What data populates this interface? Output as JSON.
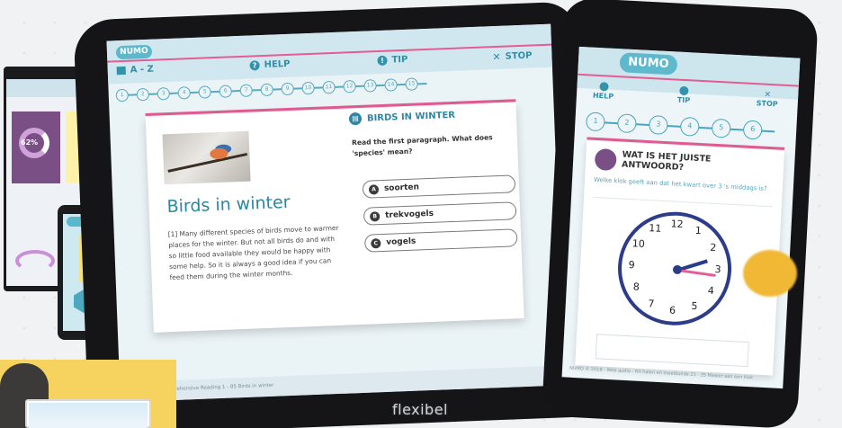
{
  "tablet": {
    "logo": "NUMO",
    "nav": {
      "az": "A - Z",
      "help": "HELP",
      "tip": "TIP",
      "stop": "STOP"
    },
    "steps": [
      "1",
      "2",
      "3",
      "4",
      "5",
      "6",
      "7",
      "8",
      "9",
      "10",
      "11",
      "12",
      "13",
      "14",
      "15"
    ],
    "lesson": {
      "title": "Birds in winter",
      "paragraph": "[1] Many different species of birds move to warmer places for the winter. But not all birds do and with so little food available they would be happy with some help. So it is always a good idea if you can feed them during the winter months."
    },
    "question": {
      "heading": "BIRDS IN WINTER",
      "text": "Read the first paragraph. What does 'species' mean?",
      "options": [
        {
          "letter": "A",
          "label": "soorten"
        },
        {
          "letter": "B",
          "label": "trekvogels"
        },
        {
          "letter": "C",
          "label": "vogels"
        }
      ]
    },
    "footer": "Web Audio - Comprehensive Reading 1 - 85 Birds in winter"
  },
  "phone": {
    "logo": "NUMO",
    "nav": {
      "help": "HELP",
      "tip": "TIP",
      "stop": "STOP"
    },
    "steps": [
      "1",
      "2",
      "3",
      "4",
      "5",
      "6"
    ],
    "question": {
      "heading": "WAT IS HET JUISTE ANTWOORD?",
      "text": "Welke klok geeft aan dat het kwart over 3 's middags is?"
    },
    "clock_numbers": [
      "12",
      "1",
      "2",
      "3",
      "4",
      "5",
      "6",
      "7",
      "8",
      "9",
      "10",
      "11"
    ],
    "footer": "NUMO © 2018 - Web audio - Rit halen en meetkunde 21 - 35 Maaier aan een klok"
  },
  "monitor": {
    "percent": "62%"
  },
  "caption": "flexibel"
}
